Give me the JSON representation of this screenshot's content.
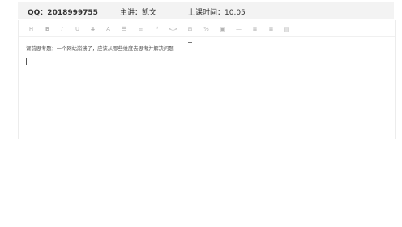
{
  "header": {
    "qq": "QQ：2018999755",
    "lecturer": "主讲：凯文",
    "class_time": "上课时间：10.05"
  },
  "toolbar": {
    "heading": "H",
    "bold": "B",
    "italic": "I",
    "underline": "U",
    "strikethrough": "S",
    "font_color": "A",
    "ordered_list": "☰",
    "unordered_list": "≡",
    "quote": "❝",
    "code": "<>",
    "table": "⊞",
    "link": "%",
    "image": "▣",
    "horizontal_rule": "—",
    "align_left": "≣",
    "align_right": "≣",
    "more": "▤"
  },
  "editor": {
    "content": "课前思考题：一个网站崩溃了，应该从哪些维度去思考并解决问题"
  }
}
